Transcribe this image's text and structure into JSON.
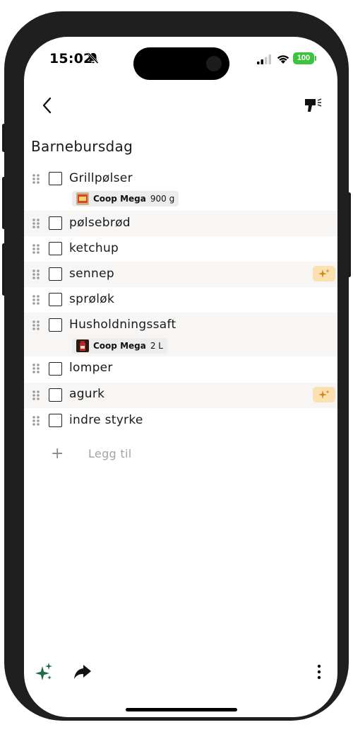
{
  "status_bar": {
    "time": "15:02",
    "battery": "100"
  },
  "list": {
    "title": "Barnebursdag",
    "items": [
      {
        "label": "Grillpølser",
        "offer": {
          "store": "Coop Mega",
          "size": "900 g"
        }
      },
      {
        "label": "pølsebrød"
      },
      {
        "label": "ketchup"
      },
      {
        "label": "sennep",
        "ai_suggested": true
      },
      {
        "label": "sprøløk"
      },
      {
        "label": "Husholdningssaft",
        "offer": {
          "store": "Coop Mega",
          "size": "2 L"
        }
      },
      {
        "label": "lomper"
      },
      {
        "label": "agurk",
        "ai_suggested": true
      },
      {
        "label": "indre styrke"
      }
    ],
    "add_placeholder": "Legg til"
  },
  "colors": {
    "accent_green": "#1e6b48",
    "ai_badge": "#fbe1b0",
    "battery": "#3cc53c"
  },
  "icons": {
    "back": "chevron-left-icon",
    "brush": "paint-brush-icon",
    "ai": "sparkles-icon",
    "share": "share-arrow-icon",
    "more": "more-vertical-icon"
  }
}
